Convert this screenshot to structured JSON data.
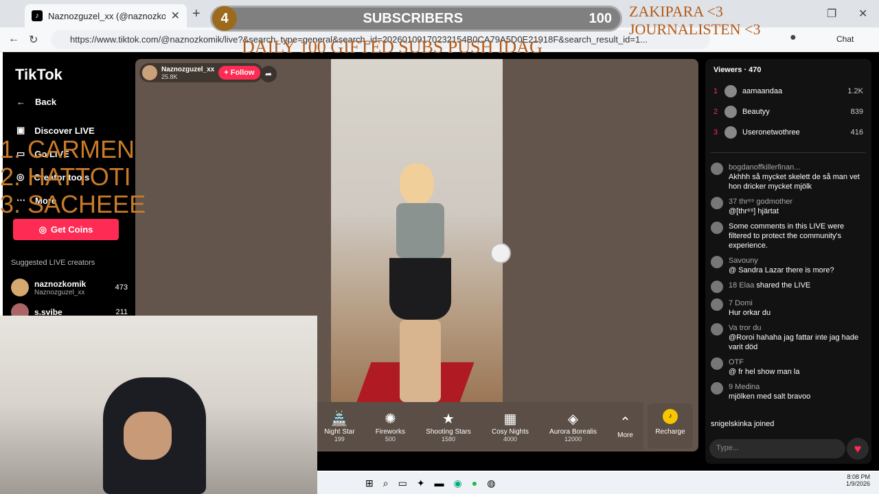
{
  "browser": {
    "tab_title": "Naznozguzel_xx (@naznozkomik",
    "url": "https://www.tiktok.com/@naznozkomik/live?&search_type=general&search_id=20260109170232154B0CA79A5D0E21918F&search_result_id=1..."
  },
  "overlay": {
    "sub_count_left": "4",
    "subscribers_label": "SUBSCRIBERS",
    "sub_goal": "100",
    "corner_line1": "ZAKIPARA <3",
    "corner_line2": "JOURNALISTEN <3",
    "daily_goal": "DAILY 100  GIFTED SUBS PUSH IDAG",
    "ranks": [
      "1. CARMEN",
      "2. HATTOTI",
      "3.  SACHEEE"
    ]
  },
  "sidebar": {
    "logo": "TikTok",
    "back": "Back",
    "items": [
      "Discover LIVE",
      "Go LIVE",
      "Creator tools",
      "More"
    ],
    "get_coins": "Get Coins",
    "suggested_title": "Suggested LIVE creators",
    "creators": [
      {
        "name": "naznozkomik",
        "handle": "Naznozguzel_xx",
        "count": "473"
      },
      {
        "name": "s.svibe",
        "handle": "",
        "count": "211"
      }
    ]
  },
  "stream": {
    "host_name": "Naznozguzel_xx",
    "likes": "25.8K",
    "follow_label": "+ Follow",
    "gifts": [
      {
        "name": "Night Star",
        "price": "199"
      },
      {
        "name": "Fireworks",
        "price": "500"
      },
      {
        "name": "Shooting Stars",
        "price": "1580"
      },
      {
        "name": "Cosy Nights",
        "price": "4000"
      },
      {
        "name": "Aurora Borealis",
        "price": "12000"
      }
    ],
    "more_label": "More",
    "recharge_label": "Recharge"
  },
  "chat": {
    "viewers_label": "Viewers · 470",
    "top_viewers": [
      {
        "rank": "1",
        "name": "aamaandaa",
        "count": "1.2K"
      },
      {
        "rank": "2",
        "name": "Beautyy",
        "count": "839"
      },
      {
        "rank": "3",
        "name": "Useronetwothree",
        "count": "416"
      }
    ],
    "messages": [
      {
        "user": "bogdanoffkillerfinan...",
        "text": "Akhhh så mycket skelett de så man vet hon dricker mycket mjölk"
      },
      {
        "user": "37  thr⁶⁹ godmother",
        "text": "@[thr⁶⁹] hjärtat"
      },
      {
        "user": "",
        "text": "Some comments in this LIVE were filtered to protect the community's experience."
      },
      {
        "user": "Savouny",
        "text": "@ Sandra Lazar there is more?"
      },
      {
        "user": "18  Elaa",
        "text": "shared the LIVE"
      },
      {
        "user": "7  Domi",
        "text": "Hur orkar du"
      },
      {
        "user": "Va tror du",
        "text": "@Roroi hahaha jag fattar inte jag hade varit död"
      },
      {
        "user": "OTF",
        "text": "@ fr hel show man la"
      },
      {
        "user": "9  Medina",
        "text": "mjölken med salt bravoo"
      },
      {
        "user": "snigelskinka",
        "text": "joined"
      }
    ],
    "input_placeholder": "Type..."
  },
  "taskbar": {
    "time": "8:08 PM",
    "date": "1/9/2026"
  },
  "chat_button": "Chat"
}
